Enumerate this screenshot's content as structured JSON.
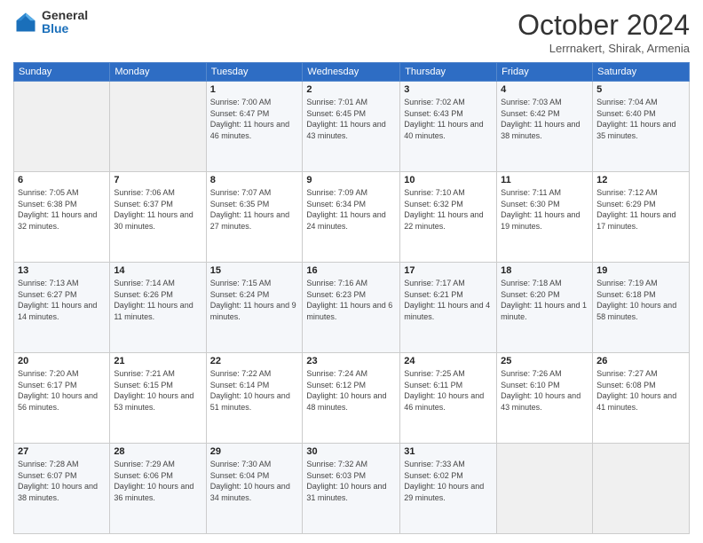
{
  "header": {
    "logo_general": "General",
    "logo_blue": "Blue",
    "title": "October 2024",
    "location": "Lerrnakert, Shirak, Armenia"
  },
  "weekdays": [
    "Sunday",
    "Monday",
    "Tuesday",
    "Wednesday",
    "Thursday",
    "Friday",
    "Saturday"
  ],
  "weeks": [
    [
      {
        "day": "",
        "info": ""
      },
      {
        "day": "",
        "info": ""
      },
      {
        "day": "1",
        "info": "Sunrise: 7:00 AM\nSunset: 6:47 PM\nDaylight: 11 hours and 46 minutes."
      },
      {
        "day": "2",
        "info": "Sunrise: 7:01 AM\nSunset: 6:45 PM\nDaylight: 11 hours and 43 minutes."
      },
      {
        "day": "3",
        "info": "Sunrise: 7:02 AM\nSunset: 6:43 PM\nDaylight: 11 hours and 40 minutes."
      },
      {
        "day": "4",
        "info": "Sunrise: 7:03 AM\nSunset: 6:42 PM\nDaylight: 11 hours and 38 minutes."
      },
      {
        "day": "5",
        "info": "Sunrise: 7:04 AM\nSunset: 6:40 PM\nDaylight: 11 hours and 35 minutes."
      }
    ],
    [
      {
        "day": "6",
        "info": "Sunrise: 7:05 AM\nSunset: 6:38 PM\nDaylight: 11 hours and 32 minutes."
      },
      {
        "day": "7",
        "info": "Sunrise: 7:06 AM\nSunset: 6:37 PM\nDaylight: 11 hours and 30 minutes."
      },
      {
        "day": "8",
        "info": "Sunrise: 7:07 AM\nSunset: 6:35 PM\nDaylight: 11 hours and 27 minutes."
      },
      {
        "day": "9",
        "info": "Sunrise: 7:09 AM\nSunset: 6:34 PM\nDaylight: 11 hours and 24 minutes."
      },
      {
        "day": "10",
        "info": "Sunrise: 7:10 AM\nSunset: 6:32 PM\nDaylight: 11 hours and 22 minutes."
      },
      {
        "day": "11",
        "info": "Sunrise: 7:11 AM\nSunset: 6:30 PM\nDaylight: 11 hours and 19 minutes."
      },
      {
        "day": "12",
        "info": "Sunrise: 7:12 AM\nSunset: 6:29 PM\nDaylight: 11 hours and 17 minutes."
      }
    ],
    [
      {
        "day": "13",
        "info": "Sunrise: 7:13 AM\nSunset: 6:27 PM\nDaylight: 11 hours and 14 minutes."
      },
      {
        "day": "14",
        "info": "Sunrise: 7:14 AM\nSunset: 6:26 PM\nDaylight: 11 hours and 11 minutes."
      },
      {
        "day": "15",
        "info": "Sunrise: 7:15 AM\nSunset: 6:24 PM\nDaylight: 11 hours and 9 minutes."
      },
      {
        "day": "16",
        "info": "Sunrise: 7:16 AM\nSunset: 6:23 PM\nDaylight: 11 hours and 6 minutes."
      },
      {
        "day": "17",
        "info": "Sunrise: 7:17 AM\nSunset: 6:21 PM\nDaylight: 11 hours and 4 minutes."
      },
      {
        "day": "18",
        "info": "Sunrise: 7:18 AM\nSunset: 6:20 PM\nDaylight: 11 hours and 1 minute."
      },
      {
        "day": "19",
        "info": "Sunrise: 7:19 AM\nSunset: 6:18 PM\nDaylight: 10 hours and 58 minutes."
      }
    ],
    [
      {
        "day": "20",
        "info": "Sunrise: 7:20 AM\nSunset: 6:17 PM\nDaylight: 10 hours and 56 minutes."
      },
      {
        "day": "21",
        "info": "Sunrise: 7:21 AM\nSunset: 6:15 PM\nDaylight: 10 hours and 53 minutes."
      },
      {
        "day": "22",
        "info": "Sunrise: 7:22 AM\nSunset: 6:14 PM\nDaylight: 10 hours and 51 minutes."
      },
      {
        "day": "23",
        "info": "Sunrise: 7:24 AM\nSunset: 6:12 PM\nDaylight: 10 hours and 48 minutes."
      },
      {
        "day": "24",
        "info": "Sunrise: 7:25 AM\nSunset: 6:11 PM\nDaylight: 10 hours and 46 minutes."
      },
      {
        "day": "25",
        "info": "Sunrise: 7:26 AM\nSunset: 6:10 PM\nDaylight: 10 hours and 43 minutes."
      },
      {
        "day": "26",
        "info": "Sunrise: 7:27 AM\nSunset: 6:08 PM\nDaylight: 10 hours and 41 minutes."
      }
    ],
    [
      {
        "day": "27",
        "info": "Sunrise: 7:28 AM\nSunset: 6:07 PM\nDaylight: 10 hours and 38 minutes."
      },
      {
        "day": "28",
        "info": "Sunrise: 7:29 AM\nSunset: 6:06 PM\nDaylight: 10 hours and 36 minutes."
      },
      {
        "day": "29",
        "info": "Sunrise: 7:30 AM\nSunset: 6:04 PM\nDaylight: 10 hours and 34 minutes."
      },
      {
        "day": "30",
        "info": "Sunrise: 7:32 AM\nSunset: 6:03 PM\nDaylight: 10 hours and 31 minutes."
      },
      {
        "day": "31",
        "info": "Sunrise: 7:33 AM\nSunset: 6:02 PM\nDaylight: 10 hours and 29 minutes."
      },
      {
        "day": "",
        "info": ""
      },
      {
        "day": "",
        "info": ""
      }
    ]
  ]
}
